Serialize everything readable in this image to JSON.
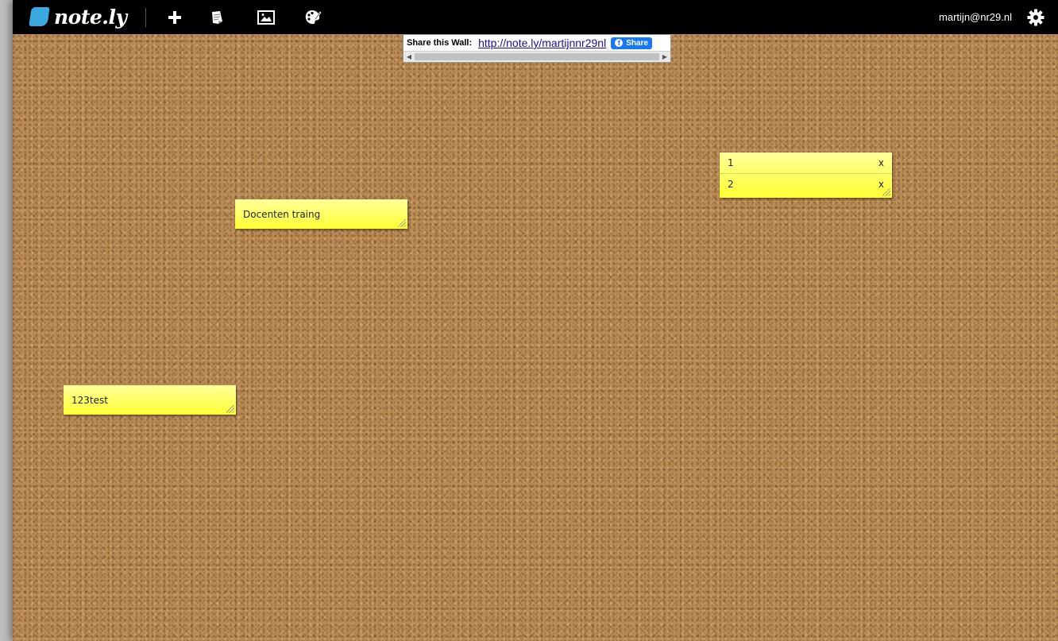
{
  "topbar": {
    "logo_text": "note.ly",
    "tools": [
      {
        "icon": "plus-icon",
        "title": "Add note"
      },
      {
        "icon": "note-icon",
        "title": "Add sticky"
      },
      {
        "icon": "image-icon",
        "title": "Add image"
      },
      {
        "icon": "palette-icon",
        "title": "Change theme"
      }
    ],
    "user_email": "martijn@nr29.nl",
    "settings_icon": "gear-icon"
  },
  "share": {
    "label": "Share this Wall:",
    "url": "http://note.ly/martijnnr29nl",
    "fb_label": "Share"
  },
  "notes": [
    {
      "id": "note-docenten",
      "text": "Docenten traing"
    },
    {
      "id": "note-123test",
      "text": "123test"
    }
  ],
  "list_note": {
    "items": [
      {
        "text": "1",
        "remove": "x"
      },
      {
        "text": "2",
        "remove": "x"
      }
    ]
  },
  "colors": {
    "topbar": "#000000",
    "note_yellow": "#ffff33",
    "cork": "#b98a54",
    "facebook_blue": "#1877f2",
    "logo_blue": "#3aa9e0"
  }
}
